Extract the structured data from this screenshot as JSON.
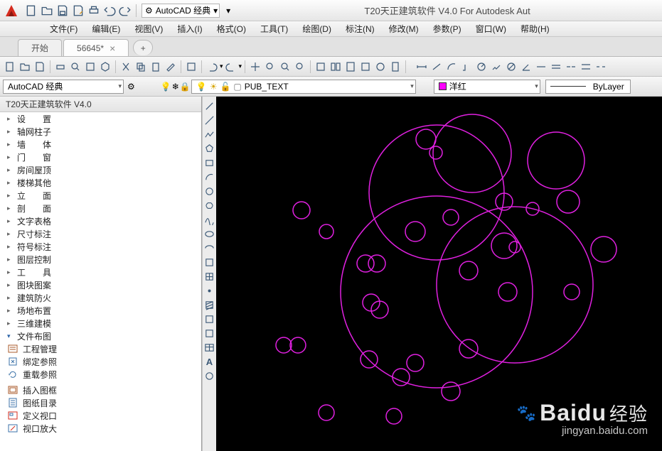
{
  "title": "T20天正建筑软件 V4.0 For Autodesk Aut",
  "workspace_quick": "AutoCAD 经典",
  "menu": [
    "文件(F)",
    "编辑(E)",
    "视图(V)",
    "插入(I)",
    "格式(O)",
    "工具(T)",
    "绘图(D)",
    "标注(N)",
    "修改(M)",
    "参数(P)",
    "窗口(W)",
    "帮助(H)"
  ],
  "tabs": {
    "start": "开始",
    "active": "56645*"
  },
  "workspace_dd": "AutoCAD 经典",
  "layer_dd": "PUB_TEXT",
  "color_dd": "洋红",
  "lineweight_dd": "ByLayer",
  "panel": {
    "title": "T20天正建筑软件 V4.0",
    "nodes": [
      {
        "label": "设　　置",
        "exp": false
      },
      {
        "label": "轴网柱子",
        "exp": false
      },
      {
        "label": "墙　　体",
        "exp": false
      },
      {
        "label": "门　　窗",
        "exp": false
      },
      {
        "label": "房间屋顶",
        "exp": false
      },
      {
        "label": "楼梯其他",
        "exp": false
      },
      {
        "label": "立　　面",
        "exp": false
      },
      {
        "label": "剖　　面",
        "exp": false
      },
      {
        "label": "文字表格",
        "exp": false
      },
      {
        "label": "尺寸标注",
        "exp": false
      },
      {
        "label": "符号标注",
        "exp": false
      },
      {
        "label": "图层控制",
        "exp": false
      },
      {
        "label": "工　　具",
        "exp": false
      },
      {
        "label": "图块图案",
        "exp": false
      },
      {
        "label": "建筑防火",
        "exp": false
      },
      {
        "label": "场地布置",
        "exp": false
      },
      {
        "label": "三维建模",
        "exp": false
      },
      {
        "label": "文件布图",
        "exp": true
      }
    ],
    "children": [
      "工程管理",
      "绑定参照",
      "重载参照",
      "插入图框",
      "图纸目录",
      "定义视口",
      "视口放大"
    ]
  },
  "watermark": {
    "brand": "Baidu",
    "suffix": "经验",
    "sub": "jingyan.baidu.com"
  }
}
